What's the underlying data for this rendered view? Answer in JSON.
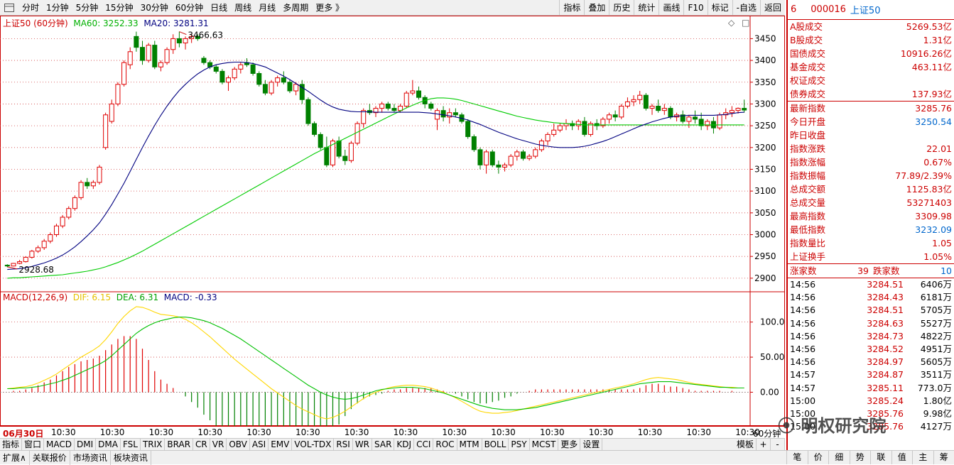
{
  "toolbar": {
    "left": [
      "分时",
      "1分钟",
      "5分钟",
      "15分钟",
      "30分钟",
      "60分钟",
      "日线",
      "周线",
      "月线",
      "多周期",
      "更多 》"
    ],
    "right": [
      "指标",
      "叠加",
      "历史",
      "统计",
      "画线",
      "F10",
      "标记",
      "-自选",
      "返回"
    ]
  },
  "legend": {
    "title": "上证50 (60分钟)",
    "ma60": "MA60: 3252.33",
    "ma20": "MA20: 3281.31",
    "high_label": "3466.63",
    "low_label": "2928.68",
    "macd_title": "MACD(12,26,9)",
    "dif": "DIF: 6.15",
    "dea": "DEA: 6.31",
    "macd": "MACD: -0.33"
  },
  "axis": {
    "price_ticks": [
      "3450",
      "3400",
      "3350",
      "3300",
      "3250",
      "3200",
      "3150",
      "3100",
      "3050",
      "3000",
      "2950",
      "2900"
    ],
    "macd_ticks": [
      "100.0",
      "50.00",
      "0.00"
    ],
    "x_labels": [
      "06月30日",
      "10:30",
      "10:30",
      "10:30",
      "10:30",
      "10:30",
      "10:30",
      "10:30",
      "10:30",
      "10:30",
      "10:30",
      "10:30",
      "10:30",
      "10:30",
      "10:30",
      "10:30"
    ],
    "period_label": "60分钟"
  },
  "chart_data": {
    "type": "candlestick",
    "title": "上证50 (60分钟)",
    "price_range": [
      2890,
      3480
    ],
    "candles": [
      [
        2930,
        2932,
        2925,
        2928
      ],
      [
        2928,
        2935,
        2927,
        2934
      ],
      [
        2934,
        2942,
        2932,
        2938
      ],
      [
        2938,
        2950,
        2936,
        2948
      ],
      [
        2948,
        2965,
        2945,
        2962
      ],
      [
        2962,
        2975,
        2958,
        2970
      ],
      [
        2970,
        2990,
        2965,
        2985
      ],
      [
        2985,
        3005,
        2980,
        3000
      ],
      [
        3000,
        3025,
        2995,
        3020
      ],
      [
        3020,
        3045,
        3015,
        3040
      ],
      [
        3040,
        3065,
        3035,
        3060
      ],
      [
        3060,
        3090,
        3055,
        3085
      ],
      [
        3085,
        3125,
        3080,
        3120
      ],
      [
        3120,
        3130,
        3105,
        3112
      ],
      [
        3112,
        3125,
        3105,
        3120
      ],
      [
        3120,
        3160,
        3115,
        3155
      ],
      [
        3200,
        3280,
        3195,
        3275
      ],
      [
        3260,
        3310,
        3255,
        3300
      ],
      [
        3300,
        3350,
        3295,
        3345
      ],
      [
        3345,
        3400,
        3340,
        3395
      ],
      [
        3390,
        3430,
        3380,
        3420
      ],
      [
        3455,
        3466,
        3420,
        3430
      ],
      [
        3430,
        3445,
        3390,
        3400
      ],
      [
        3400,
        3440,
        3395,
        3435
      ],
      [
        3435,
        3445,
        3380,
        3385
      ],
      [
        3385,
        3400,
        3375,
        3395
      ],
      [
        3395,
        3430,
        3390,
        3425
      ],
      [
        3425,
        3460,
        3415,
        3450
      ],
      [
        3450,
        3466,
        3430,
        3440
      ],
      [
        3440,
        3455,
        3425,
        3450
      ],
      [
        3450,
        3460,
        3440,
        3455
      ],
      [
        3455,
        3460,
        3445,
        3450
      ],
      [
        3405,
        3410,
        3390,
        3395
      ],
      [
        3395,
        3400,
        3380,
        3385
      ],
      [
        3385,
        3390,
        3370,
        3375
      ],
      [
        3375,
        3380,
        3345,
        3350
      ],
      [
        3350,
        3365,
        3330,
        3360
      ],
      [
        3360,
        3385,
        3355,
        3380
      ],
      [
        3380,
        3395,
        3370,
        3390
      ],
      [
        3395,
        3405,
        3385,
        3390
      ],
      [
        3390,
        3395,
        3365,
        3370
      ],
      [
        3370,
        3375,
        3340,
        3345
      ],
      [
        3345,
        3355,
        3320,
        3325
      ],
      [
        3325,
        3355,
        3320,
        3350
      ],
      [
        3350,
        3365,
        3340,
        3360
      ],
      [
        3360,
        3375,
        3345,
        3350
      ],
      [
        3350,
        3355,
        3325,
        3330
      ],
      [
        3330,
        3350,
        3320,
        3345
      ],
      [
        3345,
        3355,
        3300,
        3310
      ],
      [
        3310,
        3315,
        3250,
        3255
      ],
      [
        3255,
        3260,
        3225,
        3230
      ],
      [
        3230,
        3235,
        3195,
        3200
      ],
      [
        3200,
        3225,
        3155,
        3160
      ],
      [
        3160,
        3220,
        3155,
        3215
      ],
      [
        3215,
        3225,
        3175,
        3180
      ],
      [
        3180,
        3195,
        3160,
        3170
      ],
      [
        3170,
        3215,
        3165,
        3210
      ],
      [
        3210,
        3260,
        3205,
        3255
      ],
      [
        3255,
        3290,
        3245,
        3285
      ],
      [
        3285,
        3300,
        3275,
        3280
      ],
      [
        3280,
        3295,
        3270,
        3290
      ],
      [
        3290,
        3305,
        3280,
        3300
      ],
      [
        3300,
        3305,
        3285,
        3290
      ],
      [
        3290,
        3300,
        3280,
        3285
      ],
      [
        3285,
        3300,
        3280,
        3295
      ],
      [
        3295,
        3330,
        3290,
        3325
      ],
      [
        3325,
        3355,
        3320,
        3330
      ],
      [
        3330,
        3340,
        3310,
        3315
      ],
      [
        3315,
        3320,
        3290,
        3300
      ],
      [
        3300,
        3305,
        3285,
        3290
      ],
      [
        3265,
        3290,
        3240,
        3285
      ],
      [
        3285,
        3295,
        3260,
        3270
      ],
      [
        3270,
        3290,
        3255,
        3280
      ],
      [
        3280,
        3290,
        3270,
        3275
      ],
      [
        3275,
        3280,
        3255,
        3260
      ],
      [
        3260,
        3265,
        3220,
        3225
      ],
      [
        3225,
        3230,
        3190,
        3195
      ],
      [
        3195,
        3200,
        3150,
        3160
      ],
      [
        3160,
        3195,
        3140,
        3190
      ],
      [
        3190,
        3195,
        3155,
        3160
      ],
      [
        3160,
        3170,
        3140,
        3155
      ],
      [
        3155,
        3165,
        3145,
        3160
      ],
      [
        3160,
        3185,
        3155,
        3180
      ],
      [
        3180,
        3195,
        3170,
        3190
      ],
      [
        3190,
        3195,
        3170,
        3175
      ],
      [
        3175,
        3185,
        3170,
        3180
      ],
      [
        3180,
        3200,
        3175,
        3195
      ],
      [
        3195,
        3220,
        3190,
        3215
      ],
      [
        3215,
        3235,
        3205,
        3230
      ],
      [
        3230,
        3255,
        3225,
        3240
      ],
      [
        3240,
        3255,
        3235,
        3250
      ],
      [
        3250,
        3265,
        3240,
        3255
      ],
      [
        3255,
        3262,
        3240,
        3250
      ],
      [
        3250,
        3265,
        3240,
        3260
      ],
      [
        3260,
        3270,
        3225,
        3230
      ],
      [
        3230,
        3260,
        3225,
        3255
      ],
      [
        3255,
        3265,
        3240,
        3250
      ],
      [
        3250,
        3270,
        3245,
        3265
      ],
      [
        3265,
        3280,
        3255,
        3275
      ],
      [
        3275,
        3285,
        3260,
        3270
      ],
      [
        3270,
        3300,
        3265,
        3295
      ],
      [
        3295,
        3315,
        3290,
        3305
      ],
      [
        3305,
        3320,
        3295,
        3310
      ],
      [
        3310,
        3330,
        3300,
        3320
      ],
      [
        3320,
        3325,
        3285,
        3290
      ],
      [
        3290,
        3300,
        3275,
        3295
      ],
      [
        3295,
        3310,
        3280,
        3285
      ],
      [
        3285,
        3300,
        3275,
        3290
      ],
      [
        3290,
        3295,
        3265,
        3270
      ],
      [
        3270,
        3280,
        3260,
        3275
      ],
      [
        3275,
        3285,
        3255,
        3260
      ],
      [
        3260,
        3275,
        3245,
        3270
      ],
      [
        3270,
        3285,
        3255,
        3265
      ],
      [
        3265,
        3280,
        3240,
        3250
      ],
      [
        3250,
        3265,
        3240,
        3260
      ],
      [
        3260,
        3270,
        3232,
        3245
      ],
      [
        3245,
        3280,
        3240,
        3275
      ],
      [
        3275,
        3290,
        3265,
        3280
      ],
      [
        3280,
        3295,
        3270,
        3285
      ],
      [
        3285,
        3292,
        3278,
        3290
      ],
      [
        3290,
        3310,
        3280,
        3286
      ]
    ],
    "ma20": [
      2920,
      2921,
      2922,
      2924,
      2927,
      2931,
      2935,
      2940,
      2946,
      2953,
      2962,
      2972,
      2984,
      2997,
      3011,
      3027,
      3047,
      3069,
      3093,
      3118,
      3145,
      3173,
      3200,
      3226,
      3251,
      3274,
      3295,
      3314,
      3331,
      3345,
      3358,
      3369,
      3378,
      3385,
      3390,
      3393,
      3395,
      3396,
      3396,
      3395,
      3393,
      3389,
      3385,
      3378,
      3371,
      3364,
      3356,
      3347,
      3338,
      3329,
      3319,
      3309,
      3300,
      3293,
      3288,
      3285,
      3283,
      3282,
      3282,
      3282,
      3281,
      3281,
      3281,
      3281,
      3281,
      3281,
      3281,
      3281,
      3280,
      3279,
      3277,
      3275,
      3273,
      3270,
      3267,
      3263,
      3258,
      3253,
      3247,
      3241,
      3235,
      3230,
      3225,
      3220,
      3216,
      3212,
      3208,
      3205,
      3203,
      3201,
      3200,
      3200,
      3200,
      3201,
      3203,
      3206,
      3210,
      3214,
      3219,
      3225,
      3231,
      3237,
      3243,
      3249,
      3254,
      3259,
      3263,
      3267,
      3270,
      3272,
      3273,
      3274,
      3274,
      3274,
      3274,
      3274,
      3275,
      3276,
      3278,
      3280,
      3281
    ],
    "ma60": [
      2900,
      2901,
      2901,
      2902,
      2903,
      2904,
      2905,
      2906,
      2907,
      2908,
      2910,
      2912,
      2914,
      2916,
      2919,
      2922,
      2926,
      2931,
      2936,
      2942,
      2948,
      2955,
      2962,
      2970,
      2978,
      2986,
      2994,
      3002,
      3010,
      3018,
      3026,
      3034,
      3042,
      3050,
      3058,
      3066,
      3074,
      3082,
      3090,
      3098,
      3106,
      3114,
      3122,
      3130,
      3138,
      3146,
      3154,
      3162,
      3170,
      3178,
      3186,
      3193,
      3200,
      3207,
      3214,
      3221,
      3228,
      3235,
      3242,
      3249,
      3256,
      3263,
      3270,
      3277,
      3284,
      3291,
      3297,
      3303,
      3308,
      3312,
      3314,
      3314,
      3313,
      3311,
      3308,
      3304,
      3300,
      3296,
      3292,
      3288,
      3284,
      3280,
      3276,
      3272,
      3269,
      3266,
      3263,
      3261,
      3259,
      3257,
      3256,
      3255,
      3254,
      3253,
      3252,
      3252,
      3252,
      3252,
      3252,
      3252,
      3252,
      3252,
      3252,
      3252,
      3252,
      3252,
      3252,
      3252,
      3252,
      3252,
      3252,
      3252,
      3252,
      3252,
      3252,
      3252,
      3252,
      3252,
      3252,
      3252,
      3252
    ],
    "macd_range": [
      -40,
      130
    ],
    "dif": [
      5,
      6,
      7,
      8,
      10,
      13,
      17,
      21,
      26,
      32,
      38,
      44,
      50,
      55,
      60,
      66,
      75,
      86,
      98,
      108,
      116,
      122,
      121,
      118,
      114,
      111,
      110,
      109,
      107,
      104,
      99,
      93,
      86,
      79,
      71,
      63,
      55,
      47,
      40,
      33,
      26,
      19,
      12,
      5,
      -1,
      -7,
      -13,
      -19,
      -24,
      -28,
      -32,
      -36,
      -38,
      -36,
      -32,
      -27,
      -21,
      -15,
      -9,
      -4,
      0,
      3,
      6,
      8,
      9,
      10,
      10,
      9,
      8,
      6,
      3,
      0,
      -4,
      -8,
      -13,
      -18,
      -23,
      -27,
      -29,
      -30,
      -30,
      -29,
      -28,
      -26,
      -24,
      -22,
      -20,
      -18,
      -16,
      -14,
      -12,
      -10,
      -8,
      -6,
      -4,
      -2,
      0,
      2,
      4,
      6,
      8,
      10,
      12,
      15,
      18,
      20,
      21,
      20,
      19,
      18,
      16,
      14,
      12,
      11,
      10,
      9,
      8,
      7,
      7,
      6,
      6
    ],
    "dea": [
      5,
      5,
      6,
      6,
      7,
      8,
      10,
      12,
      14,
      17,
      20,
      24,
      28,
      32,
      36,
      40,
      45,
      52,
      60,
      68,
      76,
      84,
      90,
      95,
      99,
      102,
      104,
      106,
      107,
      107,
      106,
      104,
      102,
      99,
      95,
      91,
      86,
      81,
      76,
      70,
      64,
      58,
      52,
      46,
      40,
      34,
      28,
      22,
      16,
      10,
      5,
      0,
      -4,
      -7,
      -9,
      -10,
      -9,
      -7,
      -4,
      -1,
      2,
      4,
      5,
      6,
      7,
      7,
      7,
      6,
      5,
      3,
      1,
      -1,
      -4,
      -7,
      -10,
      -13,
      -16,
      -19,
      -21,
      -23,
      -24,
      -25,
      -25,
      -25,
      -24,
      -23,
      -22,
      -20,
      -18,
      -16,
      -14,
      -12,
      -10,
      -8,
      -6,
      -4,
      -2,
      0,
      2,
      4,
      6,
      8,
      10,
      12,
      13,
      14,
      15,
      15,
      15,
      14,
      13,
      12,
      11,
      10,
      9,
      8,
      7,
      7,
      6,
      6,
      6
    ],
    "hist_note": "MACD histogram = 2*(DIF-DEA)"
  },
  "panel": {
    "header_num": "6",
    "code": "000016",
    "name": "上证50",
    "rows1": [
      {
        "l": "A股成交",
        "v": "5269.53亿",
        "c": "#c00"
      },
      {
        "l": "B股成交",
        "v": "1.31亿",
        "c": "#c00"
      },
      {
        "l": "国债成交",
        "v": "10916.26亿",
        "c": "#c00"
      },
      {
        "l": "基金成交",
        "v": "463.11亿",
        "c": "#c00"
      },
      {
        "l": "权证成交",
        "v": "",
        "c": "#c00"
      },
      {
        "l": "债券成交",
        "v": "137.93亿",
        "c": "#c00"
      }
    ],
    "rows2": [
      {
        "l": "最新指数",
        "v": "3285.76",
        "c": "#c00"
      },
      {
        "l": "今日开盘",
        "v": "3250.54",
        "c": "#06c"
      },
      {
        "l": "昨日收盘",
        "v": "",
        "c": "#c00"
      },
      {
        "l": "指数涨跌",
        "v": "22.01",
        "c": "#c00"
      },
      {
        "l": "指数涨幅",
        "v": "0.67%",
        "c": "#c00"
      },
      {
        "l": "指数振幅",
        "v": "77.89/2.39%",
        "c": "#c00"
      },
      {
        "l": "总成交额",
        "v": "1125.83亿",
        "c": "#c00"
      },
      {
        "l": "总成交量",
        "v": "53271403",
        "c": "#c00"
      },
      {
        "l": "最高指数",
        "v": "3309.98",
        "c": "#c00"
      },
      {
        "l": "最低指数",
        "v": "3232.09",
        "c": "#06c"
      },
      {
        "l": "指数量比",
        "v": "1.05",
        "c": "#c00"
      },
      {
        "l": "上证换手",
        "v": "1.05%",
        "c": "#c00"
      }
    ],
    "updown": {
      "up_label": "涨家数",
      "up": "39",
      "down_label": "跌家数",
      "down": "10"
    },
    "ticks": [
      {
        "t": "14:56",
        "p": "3284.51",
        "v": "6406万"
      },
      {
        "t": "14:56",
        "p": "3284.43",
        "v": "6181万"
      },
      {
        "t": "14:56",
        "p": "3284.51",
        "v": "5705万"
      },
      {
        "t": "14:56",
        "p": "3284.63",
        "v": "5527万"
      },
      {
        "t": "14:56",
        "p": "3284.73",
        "v": "4822万"
      },
      {
        "t": "14:56",
        "p": "3284.52",
        "v": "4951万"
      },
      {
        "t": "14:56",
        "p": "3284.97",
        "v": "5605万"
      },
      {
        "t": "14:57",
        "p": "3284.87",
        "v": "3511万"
      },
      {
        "t": "14:57",
        "p": "3285.11",
        "v": "773.0万"
      },
      {
        "t": "15:00",
        "p": "3285.24",
        "v": "1.80亿"
      },
      {
        "t": "15:00",
        "p": "3285.76",
        "v": "9.98亿"
      },
      {
        "t": "15:00",
        "p": "3285.76",
        "v": "4127万"
      }
    ],
    "buttons": [
      "笔",
      "价",
      "细",
      "势",
      "联",
      "值",
      "主",
      "筹"
    ]
  },
  "indicators": [
    "指标",
    "窗口",
    "MACD",
    "DMI",
    "DMA",
    "FSL",
    "TRIX",
    "BRAR",
    "CR",
    "VR",
    "OBV",
    "ASI",
    "EMV",
    "VOL-TDX",
    "RSI",
    "WR",
    "SAR",
    "KDJ",
    "CCI",
    "ROC",
    "MTM",
    "BOLL",
    "PSY",
    "MCST",
    "更多",
    "设置"
  ],
  "indicator_right": [
    "模板",
    "+",
    "-"
  ],
  "bottom_tabs": [
    "扩展∧",
    "关联报价",
    "市场资讯",
    "板块资讯"
  ],
  "watermark": "明权研究院",
  "colors": {
    "up": "#e00000",
    "down": "#008000",
    "ma20": "#000080",
    "ma60": "#00cc00",
    "dif": "#ffd700",
    "dea": "#00c000"
  }
}
